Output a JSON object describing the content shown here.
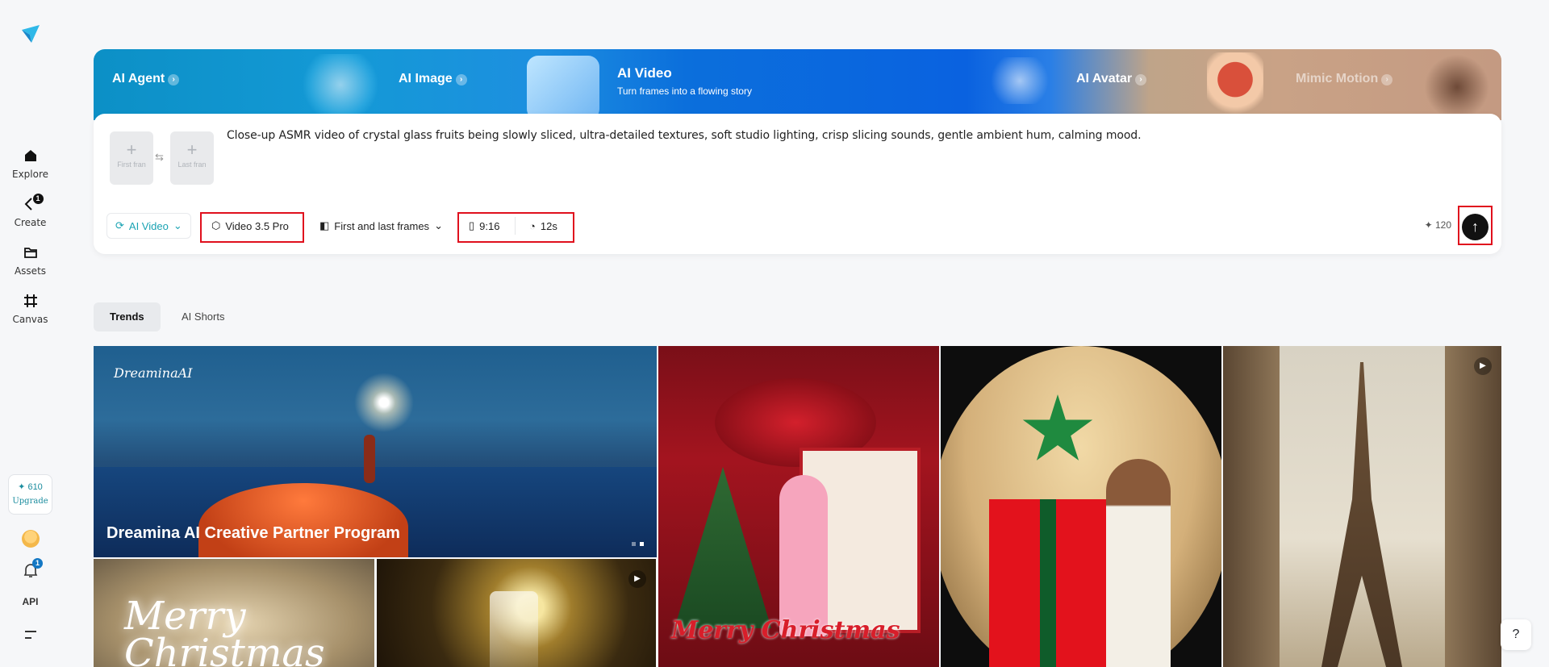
{
  "sidebar": {
    "items": [
      {
        "label": "Explore"
      },
      {
        "label": "Create",
        "badge": "1"
      },
      {
        "label": "Assets"
      },
      {
        "label": "Canvas"
      }
    ],
    "credits": "✦ 610",
    "upgrade": "Upgrade",
    "bell_badge": "1",
    "api": "API"
  },
  "banner": {
    "tabs": [
      {
        "label": "AI Agent"
      },
      {
        "label": "AI Image"
      },
      {
        "label": "AI Video",
        "subtitle": "Turn frames into a flowing story"
      },
      {
        "label": "AI Avatar"
      },
      {
        "label": "Mimic Motion"
      }
    ]
  },
  "composer": {
    "first_frame": "First fran",
    "last_frame": "Last fran",
    "prompt": "Close-up ASMR video of crystal glass fruits being slowly sliced, ultra-detailed textures, soft studio lighting, crisp slicing sounds, gentle ambient hum, calming mood.",
    "mode": "AI Video",
    "model": "Video 3.5 Pro",
    "frames_mode": "First and last frames",
    "ratio": "9:16",
    "duration": "12s",
    "cost": "✦ 120"
  },
  "filters": [
    {
      "label": "Trends"
    },
    {
      "label": "AI Shorts"
    }
  ],
  "gallery": {
    "hero_brand": "DreaminaAI",
    "hero_title": "Dreamina AI Creative Partner Program",
    "christmas_text": "Merry Christmas",
    "card_text": "Merry Christmas"
  },
  "colors": {
    "accent": "#1aa3b3",
    "highlight": "#e0101d",
    "send": "#111111"
  }
}
